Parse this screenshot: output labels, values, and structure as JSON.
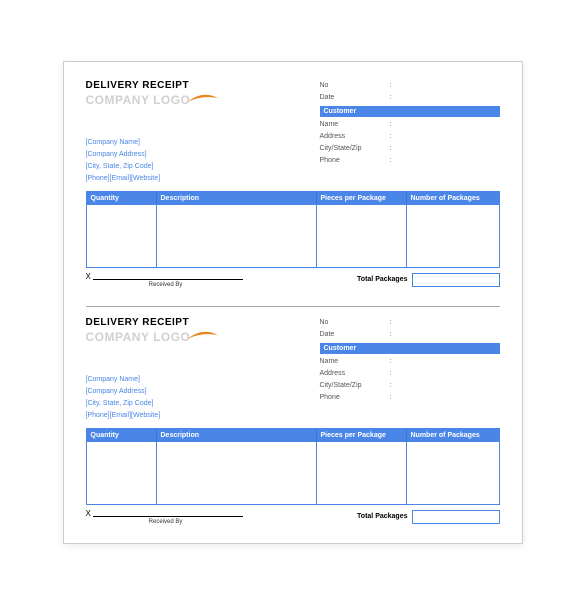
{
  "receipt": {
    "title": "DELIVERY RECEIPT",
    "logo_text": "COMPANY LOGO",
    "meta": {
      "no_label": "No",
      "date_label": "Date",
      "customer_header": "Customer",
      "name_label": "Name",
      "address_label": "Address",
      "city_label": "City/State/Zip",
      "phone_label": "Phone",
      "colon": ":"
    },
    "company": {
      "name": "[Company Name]",
      "address": "[Company Address]",
      "city": "[City, State, Zip Code]",
      "contact": "[Phone][Email][Website]"
    },
    "columns": {
      "qty": "Quantity",
      "desc": "Description",
      "pcs": "Pieces per Package",
      "num": "Number of Packages"
    },
    "footer": {
      "x": "X",
      "received_by": "Received By",
      "total": "Total Packages"
    }
  }
}
